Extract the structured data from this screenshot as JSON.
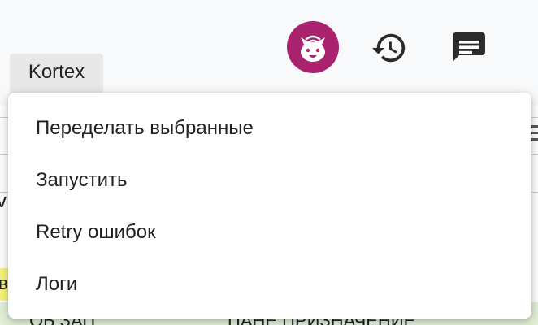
{
  "toolbar": {
    "avatar_icon": "cat-face-icon",
    "avatar_color": "#a8226e",
    "history_icon": "history-icon",
    "chat_icon": "chat-icon"
  },
  "menu_trigger": {
    "label": "Kortex"
  },
  "dropdown": {
    "items": [
      {
        "label": "Переделать выбранные"
      },
      {
        "label": "Запустить"
      },
      {
        "label": "Retry ошибок"
      },
      {
        "label": "Логи"
      }
    ]
  },
  "background": {
    "left_fragment": "v",
    "yellow_fragment": "в",
    "bottom_text_1": "ОБ ЗАП",
    "bottom_text_2": "ПАНЕ ПРИЗНАЧЕНИЕ"
  }
}
